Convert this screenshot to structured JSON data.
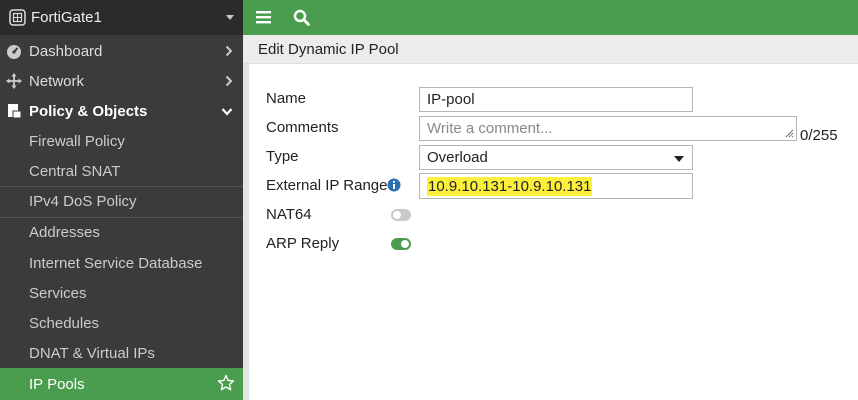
{
  "sidebar": {
    "device_name": "FortiGate1",
    "items": [
      {
        "label": "Dashboard",
        "icon": "dashboard-icon"
      },
      {
        "label": "Network",
        "icon": "network-move-icon"
      },
      {
        "label": "Policy & Objects",
        "icon": "policy-document-icon"
      }
    ],
    "subitems": [
      "Firewall Policy",
      "Central SNAT",
      "IPv4 DoS Policy",
      "Addresses",
      "Internet Service Database",
      "Services",
      "Schedules",
      "DNAT & Virtual IPs",
      "IP Pools"
    ],
    "active_subitem": "IP Pools"
  },
  "topbar": {
    "icons": [
      "menu-icon",
      "search-icon"
    ]
  },
  "page": {
    "title": "Edit Dynamic IP Pool"
  },
  "form": {
    "name_label": "Name",
    "name_value": "IP-pool",
    "comments_label": "Comments",
    "comments_placeholder": "Write a comment...",
    "comments_counter": "0/255",
    "type_label": "Type",
    "type_value": "Overload",
    "ext_range_label": "External IP Range",
    "ext_range_value": "10.9.10.131-10.9.10.131",
    "nat64_label": "NAT64",
    "nat64_on": false,
    "arp_label": "ARP Reply",
    "arp_on": true
  },
  "colors": {
    "accent_green": "#4a9d4f",
    "sidebar_bg": "#3b3b3b",
    "highlight": "#fdf03c"
  }
}
